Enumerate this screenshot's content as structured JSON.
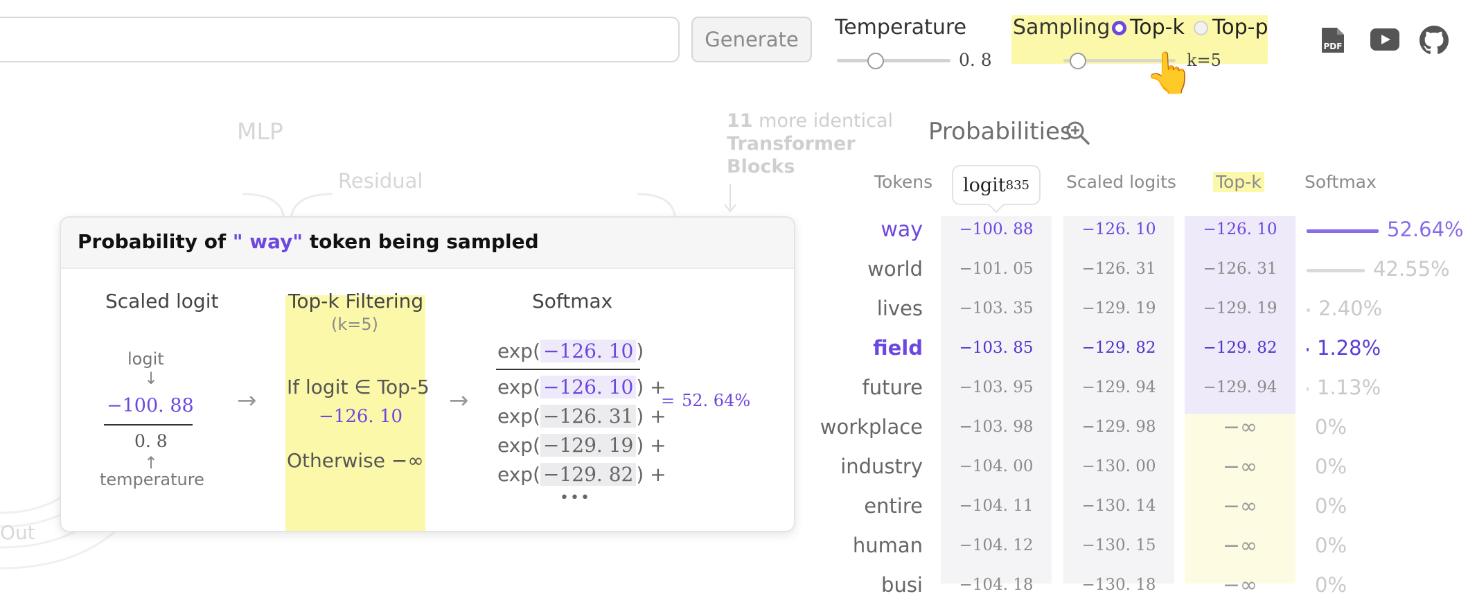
{
  "toolbar": {
    "generate_label": "Generate",
    "temperature_label": "Temperature",
    "temperature_value": "0. 8",
    "sampling_label": "Sampling",
    "topk_option": "Top-k",
    "topp_option": "Top-p",
    "k_value": "k=5",
    "selected_option": "Top-k",
    "accent_color": "#6c47e0",
    "highlight_color": "#fbf8aa"
  },
  "icons": [
    "pdf-icon",
    "youtube-icon",
    "github-icon",
    "zoom-in-icon",
    "pointer-hand-icon"
  ],
  "background": {
    "mlp": "MLP",
    "residual": "Residual",
    "more_count": "11",
    "more_text": "more identical",
    "blocks_line1": "Transformer",
    "blocks_line2": "Blocks",
    "out": "Out"
  },
  "probabilities": {
    "title": "Probabilities",
    "headers": {
      "tokens": "Tokens",
      "logit": "logit",
      "logit_sub": "835",
      "scaled": "Scaled logits",
      "topk": "Top-k",
      "softmax": "Softmax"
    },
    "rows": [
      {
        "token": "way",
        "logit": "−100. 88",
        "scaled": "−126. 10",
        "topk": "−126. 10",
        "softmax": "52.64%",
        "prob": 0.5264
      },
      {
        "token": "world",
        "logit": "−101. 05",
        "scaled": "−126. 31",
        "topk": "−126. 31",
        "softmax": "42.55%",
        "prob": 0.4255
      },
      {
        "token": "lives",
        "logit": "−103. 35",
        "scaled": "−129. 19",
        "topk": "−129. 19",
        "softmax": "2.40%",
        "prob": 0.024
      },
      {
        "token": "field",
        "logit": "−103. 85",
        "scaled": "−129. 82",
        "topk": "−129. 82",
        "softmax": "1.28%",
        "prob": 0.0128
      },
      {
        "token": "future",
        "logit": "−103. 95",
        "scaled": "−129. 94",
        "topk": "−129. 94",
        "softmax": "1.13%",
        "prob": 0.0113
      },
      {
        "token": "workplace",
        "logit": "−103. 98",
        "scaled": "−129. 98",
        "topk": "−∞",
        "softmax": "0%",
        "prob": 0
      },
      {
        "token": "industry",
        "logit": "−104. 00",
        "scaled": "−130. 00",
        "topk": "−∞",
        "softmax": "0%",
        "prob": 0
      },
      {
        "token": "entire",
        "logit": "−104. 11",
        "scaled": "−130. 14",
        "topk": "−∞",
        "softmax": "0%",
        "prob": 0
      },
      {
        "token": "human",
        "logit": "−104. 12",
        "scaled": "−130. 15",
        "topk": "−∞",
        "softmax": "0%",
        "prob": 0
      },
      {
        "token": "busi",
        "logit": "−104. 18",
        "scaled": "−130. 18",
        "topk": "−∞",
        "softmax": "0%",
        "prob": 0
      }
    ]
  },
  "card": {
    "title_prefix": "Probability of",
    "token": "\" way\"",
    "title_suffix": "token being sampled",
    "scaled_title": "Scaled logit",
    "logit_label": "logit",
    "down_arrow": "↓",
    "up_arrow": "↑",
    "logit_value": "−100. 88",
    "temp_value": "0. 8",
    "temperature_label": "temperature",
    "arrow": "→",
    "filter_title": "Top-k Filtering",
    "filter_k": "(k=5)",
    "filter_if": "If logit ∈ Top-5",
    "filter_if_value": "−126. 10",
    "filter_else": "Otherwise −∞",
    "softmax_title": "Softmax",
    "exp": "exp(",
    "close": ")",
    "close_plus": ") +",
    "numerator": "−126. 10",
    "terms": [
      "−126. 10",
      "−126. 31",
      "−129. 19",
      "−129. 82"
    ],
    "ellipsis": "•••",
    "equals": "=",
    "result": "52. 64%"
  }
}
